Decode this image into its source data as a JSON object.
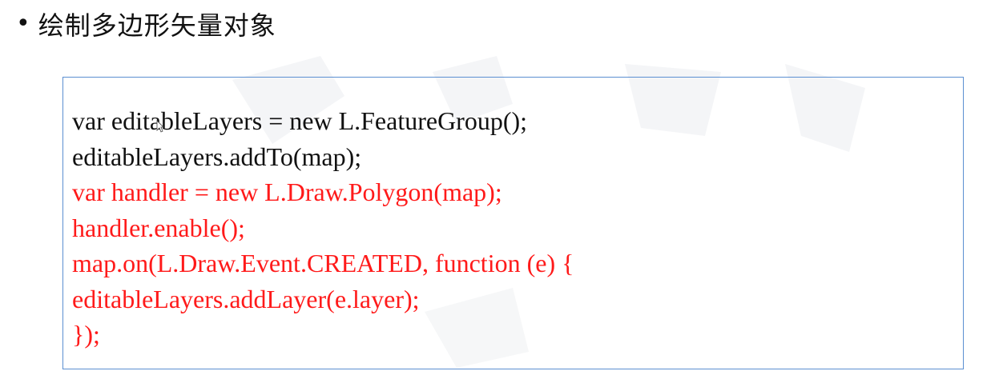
{
  "slide": {
    "bullet": "•",
    "title": "绘制多边形矢量对象"
  },
  "code": {
    "lines": [
      {
        "text": "var editableLayers = new L.FeatureGroup();",
        "color": "#111111"
      },
      {
        "text": "editableLayers.addTo(map);",
        "color": "#111111"
      },
      {
        "text": "var handler = new L.Draw.Polygon(map);",
        "color": "#ff1a1a"
      },
      {
        "text": "handler.enable();",
        "color": "#ff1a1a"
      },
      {
        "text": "map.on(L.Draw.Event.CREATED, function (e) {",
        "color": "#ff1a1a"
      },
      {
        "text": "editableLayers.addLayer(e.layer);",
        "color": "#ff1a1a"
      },
      {
        "text": "});",
        "color": "#ff1a1a"
      }
    ]
  },
  "colors": {
    "box_border": "#5b8fd1",
    "code_default": "#111111",
    "code_highlight": "#ff1a1a"
  },
  "icons": {
    "cursor": "mouse-pointer-icon"
  }
}
